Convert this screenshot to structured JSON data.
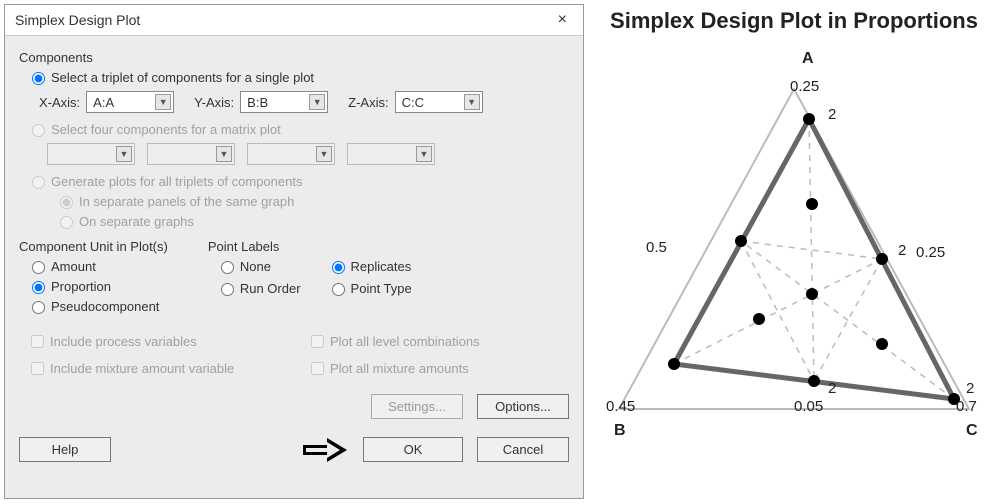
{
  "dialog": {
    "title": "Simplex Design Plot",
    "close_icon": "×",
    "components_label": "Components",
    "triplet_radio": "Select a triplet of components for a single plot",
    "x_axis_label": "X-Axis:",
    "y_axis_label": "Y-Axis:",
    "z_axis_label": "Z-Axis:",
    "x_axis_value": "A:A",
    "y_axis_value": "B:B",
    "z_axis_value": "C:C",
    "matrix_radio": "Select four components for a matrix plot",
    "all_triplets_radio": "Generate plots for all triplets of components",
    "sub_separate_panels": "In separate panels of the same graph",
    "sub_separate_graphs": "On separate graphs",
    "unit_header": "Component Unit in Plot(s)",
    "unit_amount": "Amount",
    "unit_proportion": "Proportion",
    "unit_pseudo": "Pseudocomponent",
    "point_labels_header": "Point Labels",
    "pl_none": "None",
    "pl_run_order": "Run Order",
    "pl_replicates": "Replicates",
    "pl_point_type": "Point Type",
    "chk_process_vars": "Include process variables",
    "chk_mix_amount_var": "Include mixture amount variable",
    "chk_plot_all_level": "Plot all level combinations",
    "chk_plot_all_mix": "Plot all mixture amounts",
    "btn_settings": "Settings...",
    "btn_options": "Options...",
    "btn_help": "Help",
    "btn_ok": "OK",
    "btn_cancel": "Cancel"
  },
  "chart": {
    "title": "Simplex Design Plot in Proportions",
    "vertex_a": "A",
    "vertex_b": "B",
    "vertex_c": "C",
    "tick_a": "0.25",
    "tick_b": "0.45",
    "tick_c": "0.7",
    "mid_ab": "0.5",
    "mid_ac": "0.25",
    "mid_bc": "0.05",
    "rep2": "2"
  },
  "chart_data": {
    "type": "ternary",
    "components": [
      "A",
      "B",
      "C"
    ],
    "vertex_proportions": {
      "A": 0.25,
      "B": 0.45,
      "C": 0.7
    },
    "edge_midpoints": {
      "AB": 0.5,
      "AC": 0.25,
      "BC": 0.05
    },
    "design_points_count": 10,
    "replicate_label_value": 2,
    "replicate_label_positions": [
      "near-vertex-A",
      "near-mid-AC",
      "near-mid-BC",
      "near-vertex-C"
    ],
    "grid": "dashed-internal",
    "title": "Simplex Design Plot in Proportions"
  }
}
